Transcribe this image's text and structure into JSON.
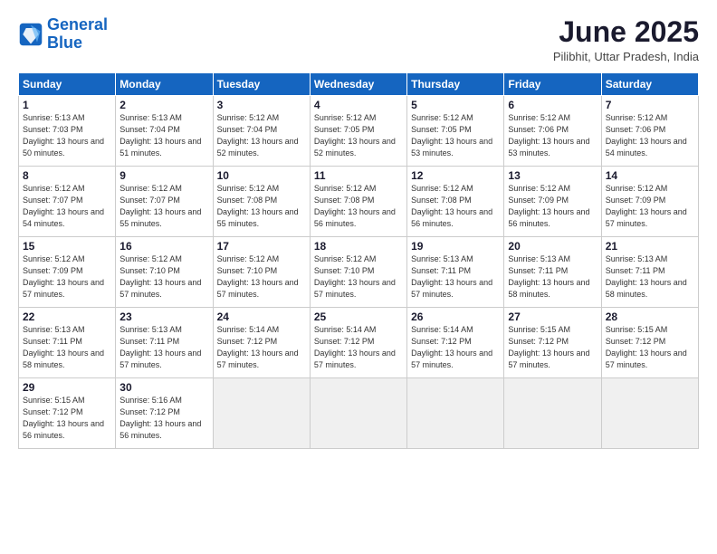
{
  "logo": {
    "line1": "General",
    "line2": "Blue"
  },
  "title": "June 2025",
  "location": "Pilibhit, Uttar Pradesh, India",
  "days_of_week": [
    "Sunday",
    "Monday",
    "Tuesday",
    "Wednesday",
    "Thursday",
    "Friday",
    "Saturday"
  ],
  "weeks": [
    [
      {
        "day": "1",
        "sunrise": "5:13 AM",
        "sunset": "7:03 PM",
        "daylight": "13 hours and 50 minutes."
      },
      {
        "day": "2",
        "sunrise": "5:13 AM",
        "sunset": "7:04 PM",
        "daylight": "13 hours and 51 minutes."
      },
      {
        "day": "3",
        "sunrise": "5:12 AM",
        "sunset": "7:04 PM",
        "daylight": "13 hours and 52 minutes."
      },
      {
        "day": "4",
        "sunrise": "5:12 AM",
        "sunset": "7:05 PM",
        "daylight": "13 hours and 52 minutes."
      },
      {
        "day": "5",
        "sunrise": "5:12 AM",
        "sunset": "7:05 PM",
        "daylight": "13 hours and 53 minutes."
      },
      {
        "day": "6",
        "sunrise": "5:12 AM",
        "sunset": "7:06 PM",
        "daylight": "13 hours and 53 minutes."
      },
      {
        "day": "7",
        "sunrise": "5:12 AM",
        "sunset": "7:06 PM",
        "daylight": "13 hours and 54 minutes."
      }
    ],
    [
      {
        "day": "8",
        "sunrise": "5:12 AM",
        "sunset": "7:07 PM",
        "daylight": "13 hours and 54 minutes."
      },
      {
        "day": "9",
        "sunrise": "5:12 AM",
        "sunset": "7:07 PM",
        "daylight": "13 hours and 55 minutes."
      },
      {
        "day": "10",
        "sunrise": "5:12 AM",
        "sunset": "7:08 PM",
        "daylight": "13 hours and 55 minutes."
      },
      {
        "day": "11",
        "sunrise": "5:12 AM",
        "sunset": "7:08 PM",
        "daylight": "13 hours and 56 minutes."
      },
      {
        "day": "12",
        "sunrise": "5:12 AM",
        "sunset": "7:08 PM",
        "daylight": "13 hours and 56 minutes."
      },
      {
        "day": "13",
        "sunrise": "5:12 AM",
        "sunset": "7:09 PM",
        "daylight": "13 hours and 56 minutes."
      },
      {
        "day": "14",
        "sunrise": "5:12 AM",
        "sunset": "7:09 PM",
        "daylight": "13 hours and 57 minutes."
      }
    ],
    [
      {
        "day": "15",
        "sunrise": "5:12 AM",
        "sunset": "7:09 PM",
        "daylight": "13 hours and 57 minutes."
      },
      {
        "day": "16",
        "sunrise": "5:12 AM",
        "sunset": "7:10 PM",
        "daylight": "13 hours and 57 minutes."
      },
      {
        "day": "17",
        "sunrise": "5:12 AM",
        "sunset": "7:10 PM",
        "daylight": "13 hours and 57 minutes."
      },
      {
        "day": "18",
        "sunrise": "5:12 AM",
        "sunset": "7:10 PM",
        "daylight": "13 hours and 57 minutes."
      },
      {
        "day": "19",
        "sunrise": "5:13 AM",
        "sunset": "7:11 PM",
        "daylight": "13 hours and 57 minutes."
      },
      {
        "day": "20",
        "sunrise": "5:13 AM",
        "sunset": "7:11 PM",
        "daylight": "13 hours and 58 minutes."
      },
      {
        "day": "21",
        "sunrise": "5:13 AM",
        "sunset": "7:11 PM",
        "daylight": "13 hours and 58 minutes."
      }
    ],
    [
      {
        "day": "22",
        "sunrise": "5:13 AM",
        "sunset": "7:11 PM",
        "daylight": "13 hours and 58 minutes."
      },
      {
        "day": "23",
        "sunrise": "5:13 AM",
        "sunset": "7:11 PM",
        "daylight": "13 hours and 57 minutes."
      },
      {
        "day": "24",
        "sunrise": "5:14 AM",
        "sunset": "7:12 PM",
        "daylight": "13 hours and 57 minutes."
      },
      {
        "day": "25",
        "sunrise": "5:14 AM",
        "sunset": "7:12 PM",
        "daylight": "13 hours and 57 minutes."
      },
      {
        "day": "26",
        "sunrise": "5:14 AM",
        "sunset": "7:12 PM",
        "daylight": "13 hours and 57 minutes."
      },
      {
        "day": "27",
        "sunrise": "5:15 AM",
        "sunset": "7:12 PM",
        "daylight": "13 hours and 57 minutes."
      },
      {
        "day": "28",
        "sunrise": "5:15 AM",
        "sunset": "7:12 PM",
        "daylight": "13 hours and 57 minutes."
      }
    ],
    [
      {
        "day": "29",
        "sunrise": "5:15 AM",
        "sunset": "7:12 PM",
        "daylight": "13 hours and 56 minutes."
      },
      {
        "day": "30",
        "sunrise": "5:16 AM",
        "sunset": "7:12 PM",
        "daylight": "13 hours and 56 minutes."
      },
      null,
      null,
      null,
      null,
      null
    ]
  ]
}
